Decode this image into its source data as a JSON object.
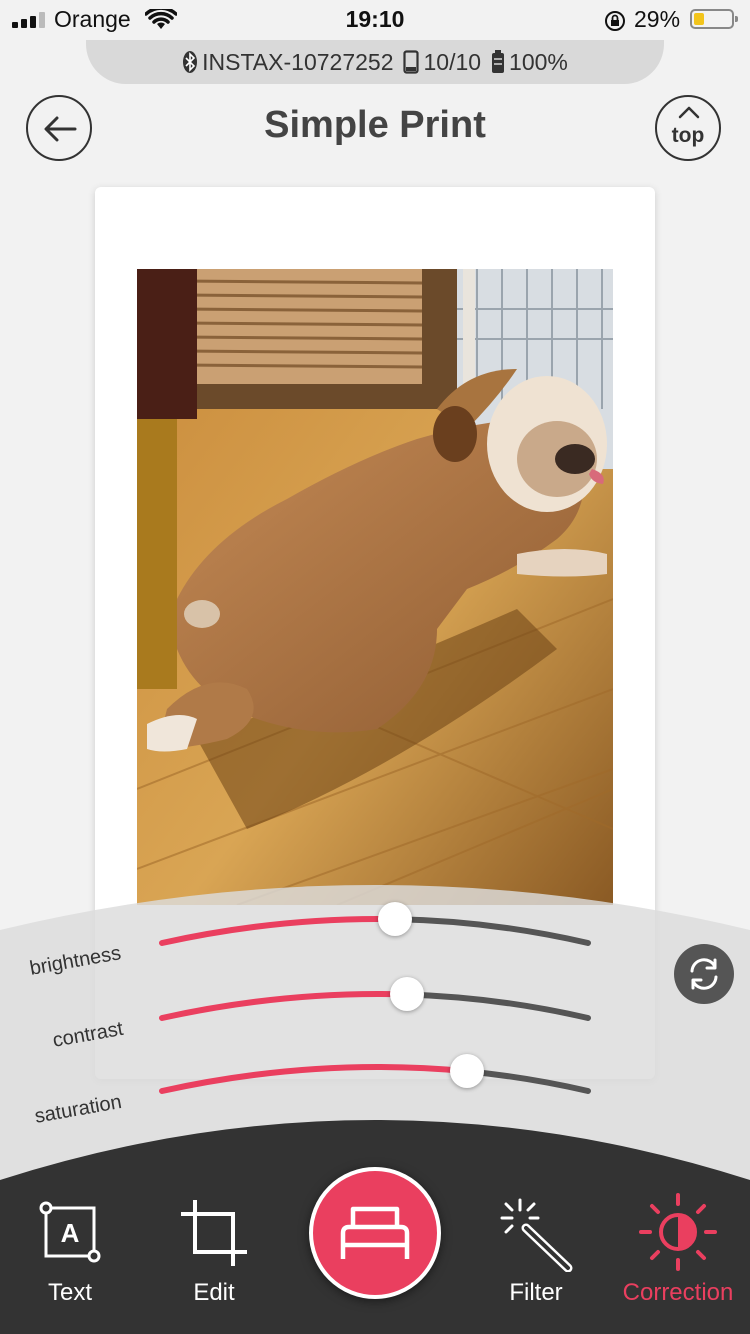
{
  "status_bar": {
    "carrier": "Orange",
    "time": "19:10",
    "battery_percent": "29%"
  },
  "printer": {
    "name": "INSTAX-10727252",
    "film": "10/10",
    "battery": "100%"
  },
  "header": {
    "title": "Simple Print",
    "top_label": "top"
  },
  "correction": {
    "sliders": [
      {
        "label": "brightness",
        "value": 0.54
      },
      {
        "label": "contrast",
        "value": 0.57
      },
      {
        "label": "saturation",
        "value": 0.71
      }
    ],
    "accent_color": "#ea3f5f",
    "track_color": "#555555"
  },
  "toolbar": {
    "text_label": "Text",
    "edit_label": "Edit",
    "filter_label": "Filter",
    "correction_label": "Correction",
    "active_tab": "Correction",
    "active_color": "#ea3f5f"
  },
  "icons": {
    "signal": "signal-bars-icon",
    "wifi": "wifi-icon",
    "lock": "orientation-lock-icon",
    "bluetooth": "bluetooth-icon",
    "film": "film-pack-icon",
    "printer_battery": "battery-icon",
    "back": "arrow-left-icon",
    "top": "chevron-up-icon",
    "refresh": "reset-icon",
    "print": "printer-icon"
  }
}
